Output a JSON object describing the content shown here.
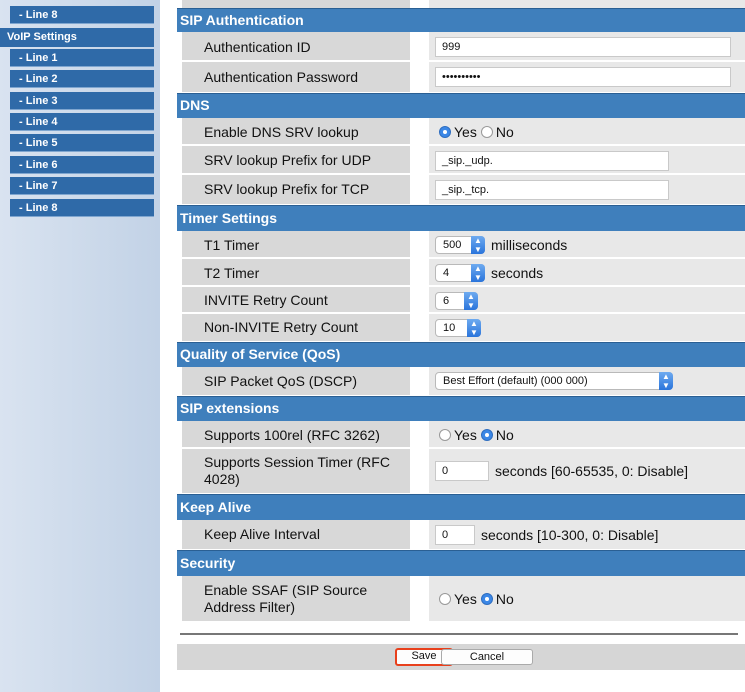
{
  "sidebar": {
    "top_item": "- Line 8",
    "section": "VoIP Settings",
    "items": [
      "- Line 1",
      "- Line 2",
      "- Line 3",
      "- Line 4",
      "- Line 5",
      "- Line 6",
      "- Line 7",
      "- Line 8"
    ]
  },
  "sip_auth": {
    "title": "SIP Authentication",
    "auth_id_label": "Authentication ID",
    "auth_id_value": "999",
    "auth_pw_label": "Authentication Password",
    "auth_pw_value": "••••••••••"
  },
  "dns": {
    "title": "DNS",
    "srv_lookup_label": "Enable DNS SRV lookup",
    "srv_lookup_selected": "Yes",
    "udp_label": "SRV lookup Prefix for UDP",
    "udp_value": "_sip._udp.",
    "tcp_label": "SRV lookup Prefix for TCP",
    "tcp_value": "_sip._tcp."
  },
  "radio": {
    "yes": "Yes",
    "no": "No"
  },
  "timer": {
    "title": "Timer Settings",
    "t1_label": "T1 Timer",
    "t1_value": "500",
    "t1_unit": "milliseconds",
    "t2_label": "T2 Timer",
    "t2_value": "4",
    "t2_unit": "seconds",
    "invite_label": "INVITE Retry Count",
    "invite_value": "6",
    "noninvite_label": "Non-INVITE Retry Count",
    "noninvite_value": "10"
  },
  "qos": {
    "title": "Quality of Service (QoS)",
    "dscp_label": "SIP Packet QoS (DSCP)",
    "dscp_value": "Best Effort (default) (000 000)"
  },
  "sip_ext": {
    "title": "SIP extensions",
    "rel100_label": "Supports 100rel (RFC 3262)",
    "rel100_selected": "No",
    "session_timer_label": "Supports Session Timer (RFC 4028)",
    "session_timer_value": "0",
    "session_timer_unit": "seconds [60-65535, 0: Disable]"
  },
  "keep_alive": {
    "title": "Keep Alive",
    "interval_label": "Keep Alive Interval",
    "interval_value": "0",
    "interval_unit": "seconds [10-300, 0: Disable]"
  },
  "security": {
    "title": "Security",
    "ssaf_label": "Enable SSAF (SIP Source Address Filter)",
    "ssaf_selected": "No"
  },
  "footer": {
    "save_label": "Save",
    "cancel_label": "Cancel"
  }
}
